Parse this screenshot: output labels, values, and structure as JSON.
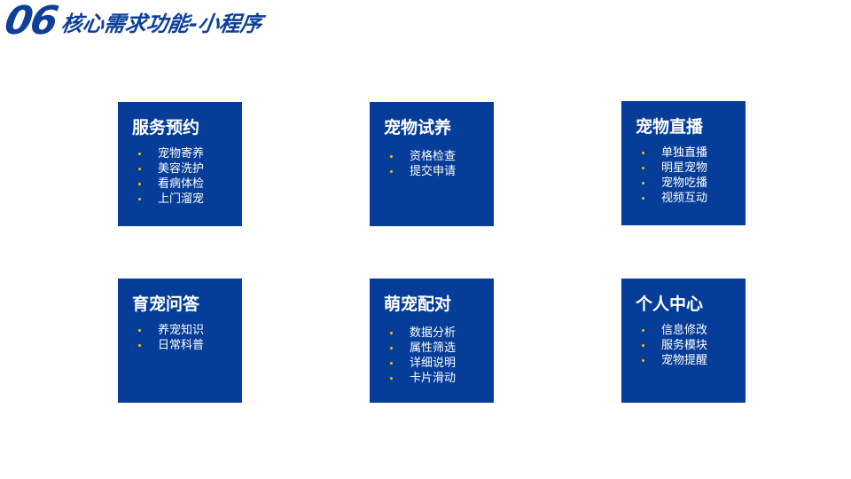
{
  "header": {
    "number": "06",
    "title": "核心需求功能-小程序"
  },
  "cards": [
    {
      "title": "服务预约",
      "items": [
        "宠物寄养",
        "美容洗护",
        "看病体检",
        "上门溜宠"
      ]
    },
    {
      "title": "宠物试养",
      "items": [
        "资格检查",
        "提交申请"
      ]
    },
    {
      "title": "宠物直播",
      "items": [
        "单独直播",
        "明星宠物",
        "宠物吃播",
        "视频互动"
      ]
    },
    {
      "title": "育宠问答",
      "items": [
        "养宠知识",
        "日常科普"
      ]
    },
    {
      "title": "萌宠配对",
      "items": [
        "数据分析",
        "属性筛选",
        "详细说明",
        "卡片滑动"
      ]
    },
    {
      "title": "个人中心",
      "items": [
        "信息修改",
        "服务模块",
        "宠物提醒"
      ]
    }
  ],
  "colors": {
    "card_background": "#053d98",
    "title_blue": "#0d3f9b",
    "bullet": "#f6c10e",
    "text_on_card": "#ffffff"
  }
}
